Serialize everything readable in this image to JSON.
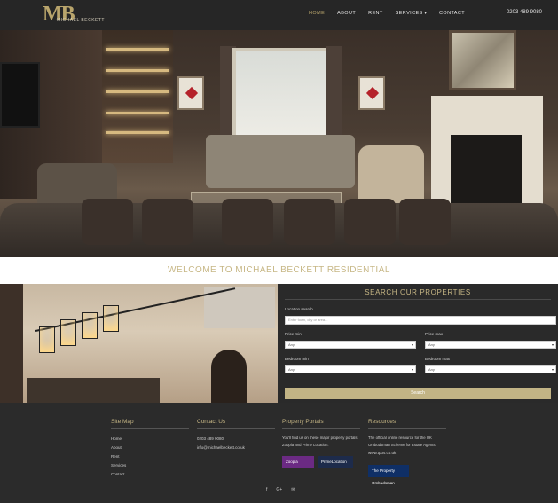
{
  "header": {
    "logo_mark": "MB",
    "logo_sub": "MICHAEL BECKETT",
    "nav": [
      {
        "label": "HOME"
      },
      {
        "label": "ABOUT"
      },
      {
        "label": "RENT"
      },
      {
        "label": "SERVICES"
      },
      {
        "label": "CONTACT"
      }
    ],
    "services_caret": "▾",
    "phone": "0203 489 9080"
  },
  "welcome": {
    "text": "WELCOME TO MICHAEL BECKETT RESIDENTIAL"
  },
  "search": {
    "title": "SEARCH OUR PROPERTIES",
    "location_label": "Location search",
    "location_placeholder": "Enter town, city or area...",
    "price_min_label": "Price min",
    "price_max_label": "Price max",
    "bedroom_min_label": "Bedroom min",
    "bedroom_max_label": "Bedroom max",
    "price_min_value": "Any",
    "price_max_value": "Any",
    "bedroom_min_value": "Any",
    "bedroom_max_value": "Any",
    "button_label": "Search"
  },
  "footer": {
    "sitemap": {
      "title": "Site Map",
      "links": [
        "Home",
        "About",
        "Rent",
        "Services",
        "Contact"
      ]
    },
    "contact": {
      "title": "Contact Us",
      "phone": "0203 489 9080",
      "email": "info@michaelbeckett.co.uk"
    },
    "portals": {
      "title": "Property Portals",
      "text": "You'll find us on these major property portals Zoopla and Prime Location.",
      "zoopla": "Zoopla",
      "prime": "PrimeLocation"
    },
    "resources": {
      "title": "Resources",
      "text": "The official online resource for the UK Ombudsman Scheme for Estate Agents.",
      "link": "www.tpos.co.uk",
      "badge": "The Property Ombudsman"
    },
    "socials": [
      {
        "glyph": "f",
        "icon": "facebook-icon"
      },
      {
        "glyph": "G+",
        "icon": "google-plus-icon"
      },
      {
        "glyph": "✉",
        "icon": "email-icon"
      }
    ]
  },
  "colors": {
    "accent": "#c7b785",
    "background": "#2b2b2b"
  }
}
